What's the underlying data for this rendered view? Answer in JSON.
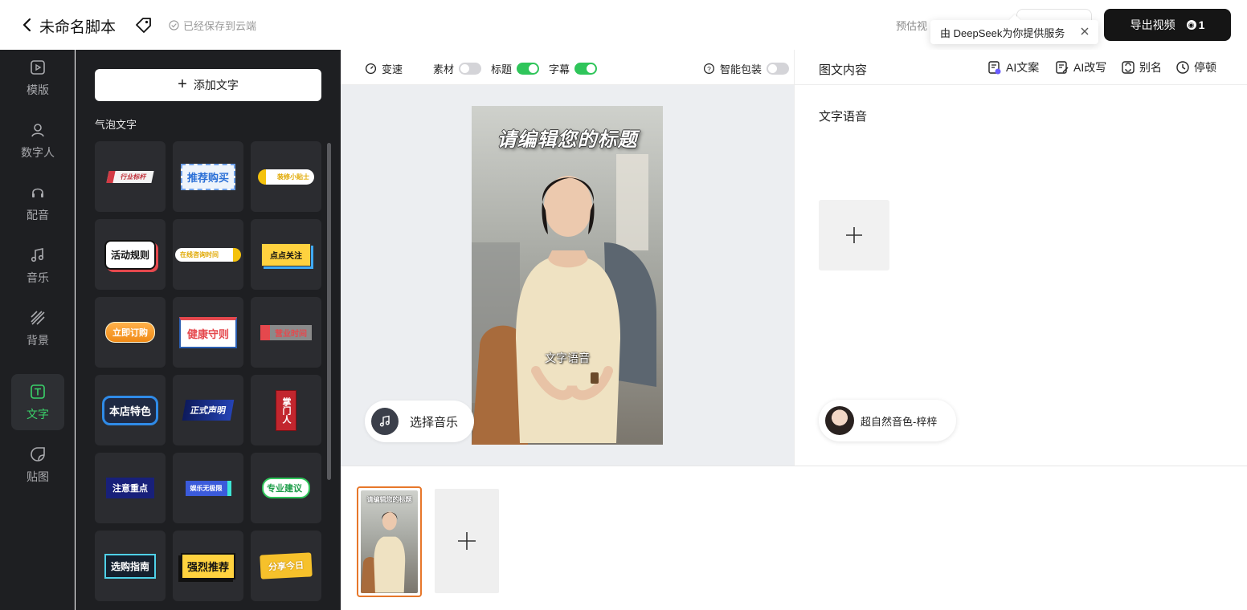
{
  "header": {
    "title": "未命名脚本",
    "saved_status": "已经保存到云端",
    "estimate_label": "预估视",
    "export_label": "导出视频",
    "export_count": "1",
    "tooltip": "由 DeepSeek为你提供服务"
  },
  "rail": {
    "items": [
      {
        "label": "模版",
        "icon": "template-icon"
      },
      {
        "label": "数字人",
        "icon": "digital-human-icon"
      },
      {
        "label": "配音",
        "icon": "voiceover-icon"
      },
      {
        "label": "音乐",
        "icon": "music-icon"
      },
      {
        "label": "背景",
        "icon": "background-icon"
      },
      {
        "label": "文字",
        "icon": "text-icon"
      },
      {
        "label": "贴图",
        "icon": "sticker-icon"
      }
    ],
    "active": "文字"
  },
  "panel": {
    "add_text_label": "添加文字",
    "section_title": "气泡文字",
    "stickers": [
      {
        "text": "行业标杆"
      },
      {
        "text": "推荐购买"
      },
      {
        "text": "装修小贴士"
      },
      {
        "text": "活动规则"
      },
      {
        "text": "在线咨询时间"
      },
      {
        "text": "点点关注"
      },
      {
        "text": "立即订购"
      },
      {
        "text": "健康守则"
      },
      {
        "text": "营业时间"
      },
      {
        "text": "本店特色"
      },
      {
        "text": "正式声明"
      },
      {
        "text": "掌门人"
      },
      {
        "text": "注意重点"
      },
      {
        "text": "娱乐无极限"
      },
      {
        "text": "专业建议"
      },
      {
        "text": "选购指南"
      },
      {
        "text": "强烈推荐"
      },
      {
        "text": "分享今日"
      }
    ]
  },
  "editor": {
    "toolbar": {
      "speed_label": "变速",
      "material_label": "素材",
      "title_label": "标题",
      "subtitle_label": "字幕",
      "smart_pack_label": "智能包装",
      "material_on": false,
      "title_on": true,
      "subtitle_on": true,
      "smart_pack_on": false
    },
    "video_title": "请编辑您的标题",
    "video_subtitle": "文字语音",
    "music_button": "选择音乐"
  },
  "right_panel": {
    "title": "图文内容",
    "actions": [
      {
        "label": "AI文案",
        "icon": "ai-copy-icon"
      },
      {
        "label": "AI改写",
        "icon": "ai-rewrite-icon"
      },
      {
        "label": "别名",
        "icon": "alias-icon"
      },
      {
        "label": "停顿",
        "icon": "pause-clock-icon"
      }
    ],
    "text_content": "文字语音",
    "voice_label": "超自然音色-梓梓"
  },
  "timeline": {
    "scene_title": "请编辑您的标题"
  },
  "colors": {
    "accent_green": "#2fc55a",
    "active_rail": "#3ad26a",
    "selected_border": "#e7772a",
    "dark_panel": "#1e1f22",
    "export_bg": "#151515"
  }
}
